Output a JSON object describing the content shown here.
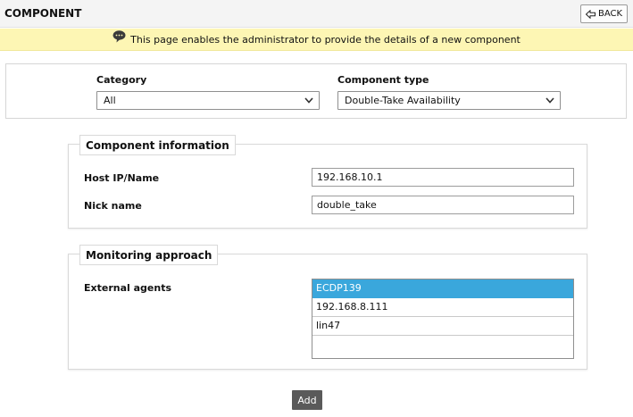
{
  "header": {
    "title": "COMPONENT",
    "back_label": "BACK"
  },
  "info": {
    "message": "This page enables the administrator to provide the details of a new component"
  },
  "filters": {
    "category_label": "Category",
    "category_value": "All",
    "component_type_label": "Component type",
    "component_type_value": "Double-Take Availability"
  },
  "component_information": {
    "legend": "Component information",
    "host_label": "Host IP/Name",
    "host_value": "192.168.10.1",
    "nick_label": "Nick name",
    "nick_value": "double_take"
  },
  "monitoring_approach": {
    "legend": "Monitoring approach",
    "agents_label": "External agents",
    "agents": [
      "ECDP139",
      "192.168.8.111",
      "lin47"
    ],
    "selected_index": 0
  },
  "actions": {
    "add_label": "Add"
  },
  "colors": {
    "info_bar_bg": "#fdf6b4",
    "selected_item_bg": "#3aa7dc",
    "add_button_bg": "#5a5a5a"
  },
  "icons": {
    "back": "back-arrow-icon",
    "info": "speech-bubble-icon",
    "dropdown": "chevron-down-icon"
  }
}
